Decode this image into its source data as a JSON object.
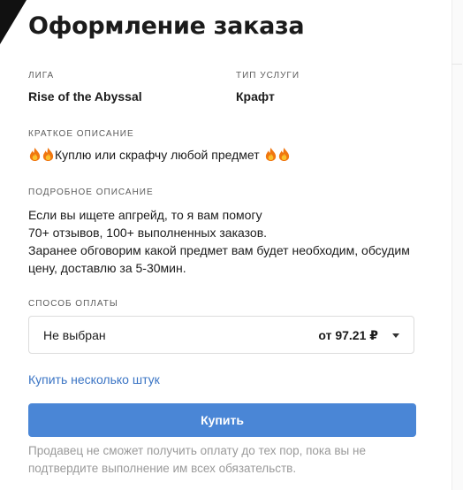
{
  "header": {
    "title": "Оформление заказа"
  },
  "league": {
    "label": "ЛИГА",
    "value": "Rise of the Abyssal"
  },
  "service_type": {
    "label": "ТИП УСЛУГИ",
    "value": "Крафт"
  },
  "short_description": {
    "label": "КРАТКОЕ ОПИСАНИЕ",
    "text": "Куплю или скрафчу любой предмет",
    "icons": [
      "fire-emoji",
      "fire-emoji",
      "fire-emoji",
      "fire-emoji"
    ]
  },
  "detailed_description": {
    "label": "ПОДРОБНОЕ ОПИСАНИЕ",
    "lines": [
      "Если вы ищете апгрейд, то я вам помогу",
      "70+ отзывов, 100+ выполненных заказов.",
      "Заранее обговорим какой предмет вам будет необходим, обсудим",
      "цену, доставлю за 5-30мин."
    ]
  },
  "payment": {
    "label": "СПОСОБ ОПЛАТЫ",
    "selected": "Не выбран",
    "price": "от 97.21 ₽"
  },
  "buy_multiple_link": "Купить несколько штук",
  "buy_button": "Купить",
  "notice_lines": [
    "Продавец не сможет получить оплату до тех пор, пока вы не",
    "подтвердите выполнение им всех обязательств."
  ],
  "colors": {
    "accent": "#4a86d6",
    "link": "#3a74c4",
    "muted": "#9a9a9a"
  }
}
